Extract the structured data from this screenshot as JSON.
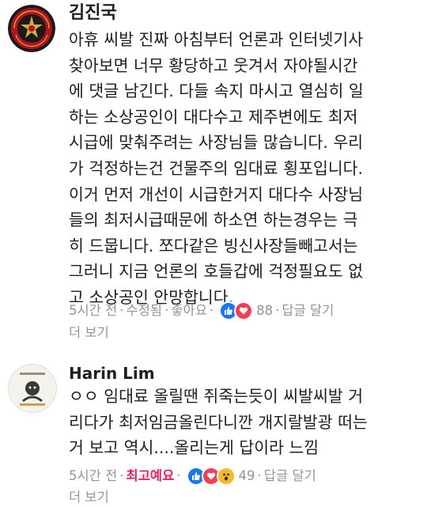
{
  "comments": [
    {
      "author": "김진국",
      "avatar_text": "KOREA MARINE CORPS",
      "lines": [
        "아휴 씨발 진짜 아침부터 언론과 인터넷기사",
        "찾아보면 너무 황당하고 웃겨서 자야될시간",
        "에 댓글 남긴다. 다들 속지 마시고 열심히 일",
        "하는 소상공인이 대다수고 제주변에도 최저",
        "시급에 맞춰주려는 사장님들 많습니다. 우리",
        "가 걱정하는건 건물주의 임대료 횡포입니다.",
        "이거 먼저 개선이 시급한거지 대다수 사장님",
        "들의 최저시급때문에 하소연 하는경우는 극",
        "히 드뭅니다. 쪼다같은 빙신사장들빼고서는",
        "그러니 지금 언론의 호들갑에 걱정필요도 없",
        "고 소상공인 안망합니다."
      ],
      "time": "5시간 전",
      "edited": "수정됨",
      "like_label": "좋아요",
      "reactions": [
        "like-icon",
        "love-icon"
      ],
      "reaction_count": "88",
      "reply_label": "답글 달기",
      "more_label": "더 보기"
    },
    {
      "author": "Harin Lim",
      "lines": [
        "ㅇㅇ 임대료 올릴땐 쥐죽는듯이 씨발씨발 거",
        "리다가 최저임금올린다니깐 개지랄발광 떠는",
        "거 보고 역시....올리는게 답이라 느낌"
      ],
      "time": "5시간 전",
      "like_label": "최고예요",
      "reactions": [
        "like-icon",
        "love-icon",
        "wow-icon"
      ],
      "reaction_count": "49",
      "reply_label": "답글 달기",
      "more_label": "더 보기"
    }
  ],
  "colors": {
    "text": "#1c1e21",
    "meta": "#90949c",
    "love_active": "#e0245e",
    "like_blue": "#1877f2",
    "love_red": "#f33e58",
    "wow_yellow": "#f7b928"
  }
}
